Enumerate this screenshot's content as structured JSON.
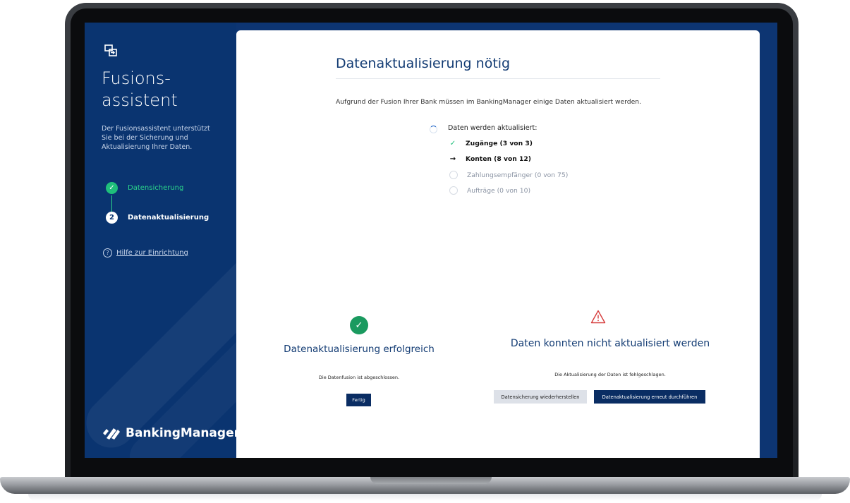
{
  "sidebar": {
    "title": "Fusions-\nassistent",
    "description": "Der Fusionsassistent unterstützt Sie bei der Sicherung und Aktualisierung Ihrer Daten.",
    "steps": [
      {
        "number": "1",
        "label": "Datensicherung",
        "status": "done"
      },
      {
        "number": "2",
        "label": "Datenaktualisierung",
        "status": "active"
      }
    ],
    "help_link": "Hilfe zur Einrichtung",
    "brand": "BankingManager"
  },
  "main": {
    "title": "Datenaktualisierung nötig",
    "intro": "Aufgrund der Fusion Ihrer Bank müssen im BankingManager einige Daten aktualisiert werden.",
    "progress": {
      "title": "Daten werden aktualisiert:",
      "items": [
        {
          "label": "Zugänge (3 von 3)",
          "status": "done"
        },
        {
          "label": "Konten (8 von 12)",
          "status": "in-progress"
        },
        {
          "label": "Zahlungsempfänger (0 von 75)",
          "status": "pending"
        },
        {
          "label": "Aufträge (0 von 10)",
          "status": "pending"
        }
      ]
    }
  },
  "success": {
    "title": "Datenaktualisierung erfolgreich",
    "text": "Die Datenfusion ist abgeschlossen.",
    "button": "Fertig"
  },
  "error": {
    "title": "Daten konnten nicht aktualisiert werden",
    "text": "Die Aktualisierung der Daten ist fehlgeschlagen.",
    "restore_button": "Datensicherung wiederherstellen",
    "retry_button": "Datenaktualisierung erneut durchführen"
  },
  "colors": {
    "sidebar_bg": "#0a3470",
    "accent_green": "#1fbf7b",
    "primary_button": "#0a2d63",
    "title_text": "#123b73",
    "warning_red": "#d63b3b"
  }
}
